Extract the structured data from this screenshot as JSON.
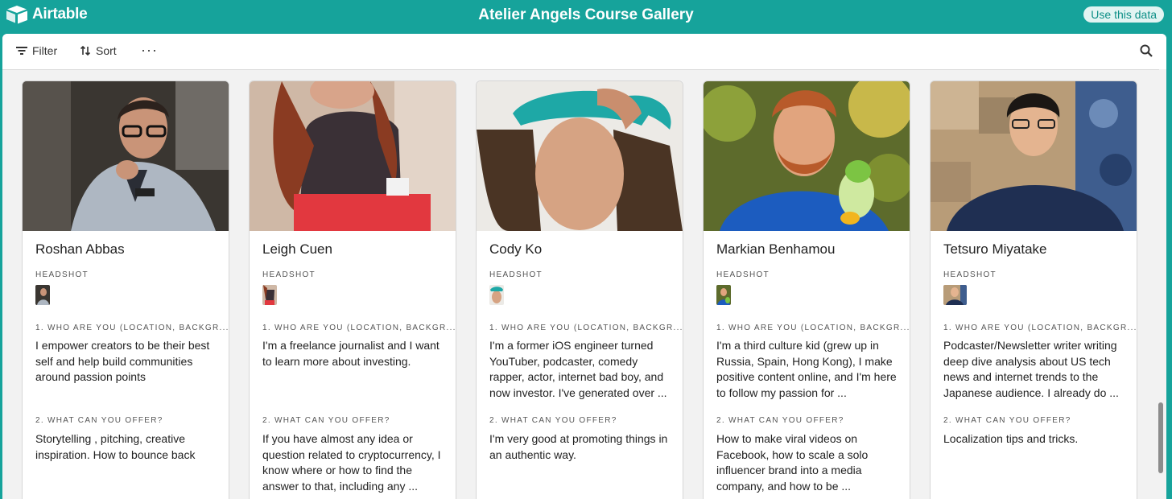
{
  "app": {
    "brand": "Airtable",
    "title": "Atelier Angels Course Gallery",
    "use_data": "Use this data"
  },
  "toolbar": {
    "filter": "Filter",
    "sort": "Sort",
    "more": "···"
  },
  "fields": {
    "headshot": "HEADSHOT",
    "who": "1. WHO ARE YOU (LOCATION, BACKGR...",
    "offer": "2. WHAT CAN YOU OFFER?"
  },
  "cards": [
    {
      "name": "Roshan Abbas",
      "who": "I empower creators to be their best self and help build communities around passion points",
      "offer": "Storytelling , pitching, creative inspiration. How to bounce back"
    },
    {
      "name": "Leigh Cuen",
      "who": "I'm a freelance journalist and I want to learn more about investing.",
      "offer": "If you have almost any idea or question related to cryptocurrency, I know where or how to find the answer to that, including any ..."
    },
    {
      "name": "Cody Ko",
      "who": "I'm a former iOS engineer turned YouTuber, podcaster, comedy rapper, actor, internet bad boy, and now investor. I've generated over ...",
      "offer": "I'm very good at promoting things in an authentic way."
    },
    {
      "name": "Markian Benhamou",
      "who": "I'm a third culture kid (grew up in Russia, Spain, Hong Kong), I make positive content online, and I'm here to follow my passion for ...",
      "offer": "How to make viral videos on Facebook, how to scale a solo influencer brand into a media company, and how to be ..."
    },
    {
      "name": "Tetsuro Miyatake",
      "who": "Podcaster/Newsletter writer writing deep dive analysis about US tech news and internet trends to the Japanese audience. I already do ...",
      "offer": "Localization tips and tricks."
    }
  ]
}
